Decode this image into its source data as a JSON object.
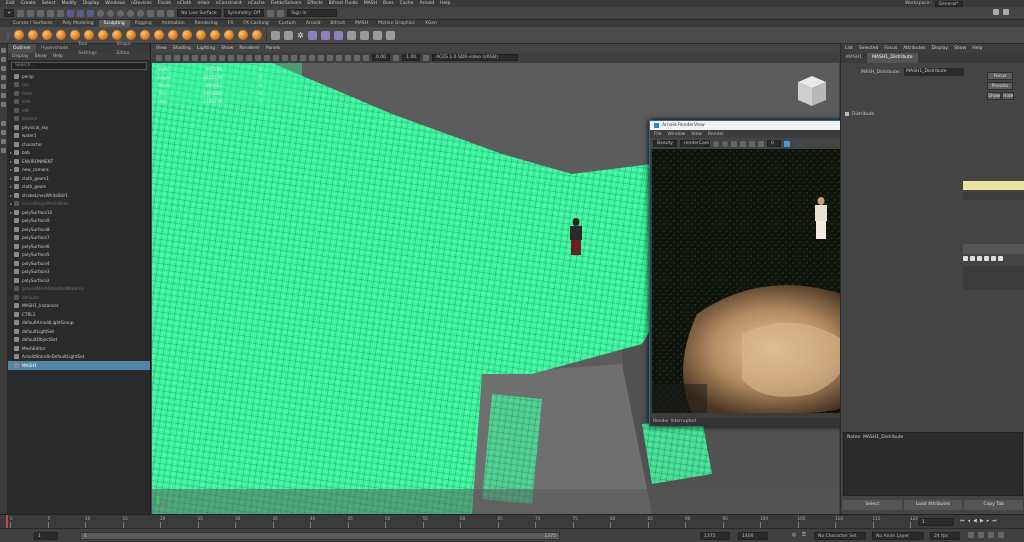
{
  "menubar": [
    "Edit",
    "Create",
    "Select",
    "Modify",
    "Display",
    "Windows",
    "nDevices",
    "Fluids",
    "nCloth",
    "nHair",
    "nConstraint",
    "nCache",
    "Fields/Solvers",
    "Effects",
    "Bifrost Fluids",
    "MASH",
    "Boss",
    "Cache",
    "Arnold",
    "Help"
  ],
  "workspace": {
    "label": "Workspace :",
    "value": "General*"
  },
  "statusline": {
    "live_surface": "No Live Surface",
    "symmetry": "Symmetry: Off",
    "sign_in": "Sign In"
  },
  "shelf_tabs": [
    "Curves / Surfaces",
    "Poly Modeling",
    "Sculpting",
    "Rigging",
    "Animation",
    "Rendering",
    "FX",
    "FX Caching",
    "Custom",
    "Arnold",
    "Bifrost",
    "MASH",
    "Motion Graphics",
    "XGen"
  ],
  "shelf_active_tab": "Sculpting",
  "outliner": {
    "tabs": [
      "Outliner",
      "Hypershade",
      "Tool Settings",
      "Shape Editor"
    ],
    "menu": [
      "Display",
      "Show",
      "Help"
    ],
    "search_placeholder": "Search...",
    "items": [
      {
        "label": "persp",
        "state": "normal"
      },
      {
        "label": "top",
        "state": "dim"
      },
      {
        "label": "front",
        "state": "dim"
      },
      {
        "label": "side",
        "state": "dim"
      },
      {
        "label": "left",
        "state": "dim"
      },
      {
        "label": "bottom",
        "state": "dim"
      },
      {
        "label": "physical_sky",
        "state": "normal"
      },
      {
        "label": "water1",
        "state": "normal"
      },
      {
        "label": "character",
        "state": "normal"
      },
      {
        "label": "bob",
        "state": "normal"
      },
      {
        "label": "ENVIRONMENT",
        "state": "normal"
      },
      {
        "label": "new_camera",
        "state": "normal"
      },
      {
        "label": "cloth_geom1",
        "state": "normal"
      },
      {
        "label": "cloth_geom",
        "state": "normal"
      },
      {
        "label": "strokeLinesWhiteBdr1",
        "state": "normal"
      },
      {
        "label": "curveShapeMeshNode",
        "state": "dim"
      },
      {
        "label": "polySurface10",
        "state": "normal"
      },
      {
        "label": "polySurface9",
        "state": "normal"
      },
      {
        "label": "polySurface8",
        "state": "normal"
      },
      {
        "label": "polySurface7",
        "state": "normal"
      },
      {
        "label": "polySurface6",
        "state": "normal"
      },
      {
        "label": "polySurface5",
        "state": "normal"
      },
      {
        "label": "polySurface4",
        "state": "normal"
      },
      {
        "label": "polySurface3",
        "state": "normal"
      },
      {
        "label": "polySurface2",
        "state": "normal"
      },
      {
        "label": "groundMeshStandardMaterial",
        "state": "dim"
      },
      {
        "label": "defaults",
        "state": "dim"
      },
      {
        "label": "MASH1_Instancer",
        "state": "normal"
      },
      {
        "label": "CTRL1",
        "state": "normal"
      },
      {
        "label": "defaultArnoldLightGroup",
        "state": "normal"
      },
      {
        "label": "defaultLightSet",
        "state": "normal"
      },
      {
        "label": "defaultObjectSet",
        "state": "normal"
      },
      {
        "label": "MeshEditor",
        "state": "normal"
      },
      {
        "label": "ArnoldStandInDefaultLightSet",
        "state": "normal"
      },
      {
        "label": "MASH1",
        "state": "selected"
      }
    ]
  },
  "viewport": {
    "menu": [
      "View",
      "Shading",
      "Lighting",
      "Show",
      "Renderer",
      "Panels"
    ],
    "hud": [
      {
        "k": "Verts:",
        "v1": "957789",
        "v2": "0"
      },
      {
        "k": "Edges:",
        "v1": "1915578",
        "v2": "0"
      },
      {
        "k": "Faces:",
        "v1": "960052",
        "v2": "0"
      },
      {
        "k": "Tris:",
        "v1": "1915600",
        "v2": "0"
      },
      {
        "k": "UVs:",
        "v1": "1190274",
        "v2": "0"
      }
    ],
    "exposure": "0.00",
    "gamma": "1.00",
    "colorspace": "ACES 1.0 SDR-video (sRGB)"
  },
  "render_view": {
    "title": "Arnold RenderView",
    "menu": [
      "File",
      "Window",
      "View",
      "Render"
    ],
    "aov": "Beauty",
    "camera": "renderCam",
    "status": "Render Interrupted",
    "zoom": "0"
  },
  "attribute_editor": {
    "menu": [
      "List",
      "Selected",
      "Focus",
      "Attributes",
      "Display",
      "Show",
      "Help"
    ],
    "tabs": [
      "MASH1",
      "MASH1_Distribute"
    ],
    "node_label": "MASH_Distribute:",
    "node_value": "MASH1_Distribute",
    "btn_focus": "Focus",
    "btn_presets": "Presets",
    "btn_show": "Show",
    "btn_hide": "Hide",
    "section": "Distribute",
    "notes_label": "Notes: MASH1_Distribute",
    "bottom_buttons": [
      "Select",
      "Load Attributes",
      "Copy Tab"
    ]
  },
  "timeline": {
    "ticks": [
      "0",
      "5",
      "10",
      "15",
      "20",
      "25",
      "30",
      "35",
      "40",
      "45",
      "50",
      "55",
      "60",
      "65",
      "70",
      "75",
      "80",
      "85",
      "90",
      "95",
      "100",
      "105",
      "110",
      "115",
      "120"
    ],
    "current": "1"
  },
  "range": {
    "start": "1",
    "inner_start": "1",
    "inner_end": "1375",
    "end": "1375",
    "end2": "1400",
    "character_set": "No Character Set",
    "anim_layer": "No Anim Layer",
    "fps": "24 fps"
  },
  "colors": {
    "accent": "#5285a6",
    "instancer_green": "#3cf5a0",
    "selection_blue": "#1c6aa0"
  }
}
